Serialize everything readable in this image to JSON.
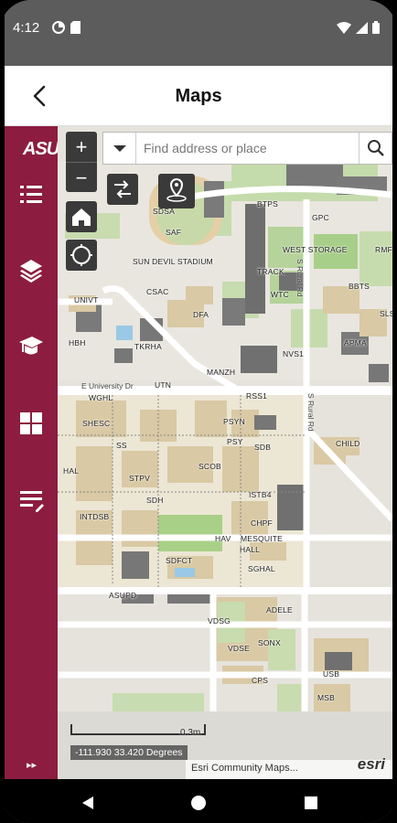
{
  "status_bar": {
    "time": "4:12",
    "left_icons": [
      "data-saver-icon",
      "sim-icon"
    ],
    "right_icons": [
      "wifi-icon",
      "signal-icon",
      "battery-icon"
    ]
  },
  "app_bar": {
    "title": "Maps",
    "back_icon": "back-arrow-icon"
  },
  "sidebar": {
    "logo_text": "ASU",
    "accent_color": "#8c1d40",
    "items": [
      {
        "name": "list-icon"
      },
      {
        "name": "layers-icon"
      },
      {
        "name": "graduation-cap-icon"
      },
      {
        "name": "grid-icon"
      },
      {
        "name": "notes-icon"
      }
    ],
    "expand_label": "▸▸"
  },
  "map": {
    "search": {
      "placeholder": "Find address or place",
      "value": ""
    },
    "zoom_in_label": "+",
    "zoom_out_label": "−",
    "tools": [
      "directions-icon",
      "location-pin-icon",
      "home-icon",
      "locate-icon"
    ],
    "scale_label": "0.3m",
    "coordinates": "-111.930 33.420 Degrees",
    "attribution": "Esri Community Maps...",
    "esri_logo": "esri",
    "labels": [
      {
        "text": "SDSA"
      },
      {
        "text": "SAF"
      },
      {
        "text": "SUN DEVIL STADIUM"
      },
      {
        "text": "CSAC"
      },
      {
        "text": "BTPS"
      },
      {
        "text": "GPC"
      },
      {
        "text": "WEST STORAGE"
      },
      {
        "text": "RMF"
      },
      {
        "text": "TRACK"
      },
      {
        "text": "BBTS"
      },
      {
        "text": "WTC"
      },
      {
        "text": "UNIVT"
      },
      {
        "text": "DFA"
      },
      {
        "text": "SLS"
      },
      {
        "text": "HBH"
      },
      {
        "text": "TKRHA"
      },
      {
        "text": "NVS1"
      },
      {
        "text": "APMA"
      },
      {
        "text": "MANZH"
      },
      {
        "text": "UTN"
      },
      {
        "text": "WGHL"
      },
      {
        "text": "RSS1"
      },
      {
        "text": "SHESC"
      },
      {
        "text": "PSYN"
      },
      {
        "text": "SS"
      },
      {
        "text": "PSY"
      },
      {
        "text": "SDB"
      },
      {
        "text": "CHILD"
      },
      {
        "text": "HAL"
      },
      {
        "text": "SCOB"
      },
      {
        "text": "STPV"
      },
      {
        "text": "ISTB4"
      },
      {
        "text": "SDH"
      },
      {
        "text": "INTDSB"
      },
      {
        "text": "CHPF"
      },
      {
        "text": "HAV"
      },
      {
        "text": "MESQUITE"
      },
      {
        "text": "HALL"
      },
      {
        "text": "SDFCT"
      },
      {
        "text": "SGHAL"
      },
      {
        "text": "ASUPD"
      },
      {
        "text": "ADELE"
      },
      {
        "text": "VDSG"
      },
      {
        "text": "SONX"
      },
      {
        "text": "VDSE"
      },
      {
        "text": "USB"
      },
      {
        "text": "CPS"
      },
      {
        "text": "MSB"
      }
    ],
    "streets": [
      {
        "text": "S Rural Rd"
      },
      {
        "text": "S Rural Rd"
      },
      {
        "text": "E University Dr"
      }
    ]
  },
  "nav_bar": {
    "buttons": [
      "back-triangle-icon",
      "home-circle-icon",
      "recents-square-icon"
    ]
  }
}
